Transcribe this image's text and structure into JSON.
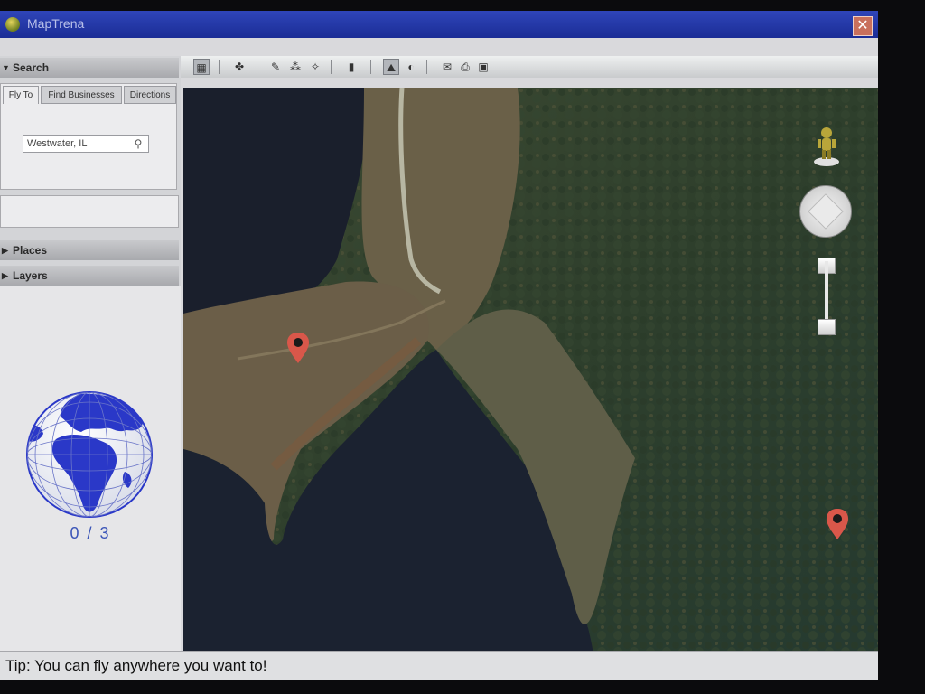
{
  "window": {
    "title": "MapTrena"
  },
  "toolbar": {
    "buttons": [
      {
        "icon": "sidebar-toggle-icon",
        "glyph": "▦"
      },
      {
        "icon": "placemark-icon",
        "glyph": "✤"
      },
      {
        "icon": "polygon-icon",
        "glyph": "✎"
      },
      {
        "icon": "path-icon",
        "glyph": "⁂"
      },
      {
        "icon": "overlay-icon",
        "glyph": "✧"
      },
      {
        "icon": "record-tour-icon",
        "glyph": "▮"
      },
      {
        "icon": "historical-imagery-icon",
        "glyph": "⛰"
      },
      {
        "icon": "sun-icon",
        "glyph": "◐"
      },
      {
        "icon": "email-icon",
        "glyph": "✉"
      },
      {
        "icon": "print-icon",
        "glyph": "⎙"
      },
      {
        "icon": "save-image-icon",
        "glyph": "▣"
      }
    ]
  },
  "sidebar": {
    "search_header": "Search",
    "tabs": [
      "Fly To",
      "Find Businesses",
      "Directions"
    ],
    "search_value": "Westwater, IL",
    "places_header": "Places",
    "layers_header": "Layers"
  },
  "globe": {
    "counter": "0 / 3"
  },
  "status": {
    "tip": "Tip: You can fly anywhere you want to!"
  },
  "colors": {
    "titlebar": "#1b2d96",
    "marker": "#d9574a",
    "globe_blue": "#2a38c8"
  }
}
